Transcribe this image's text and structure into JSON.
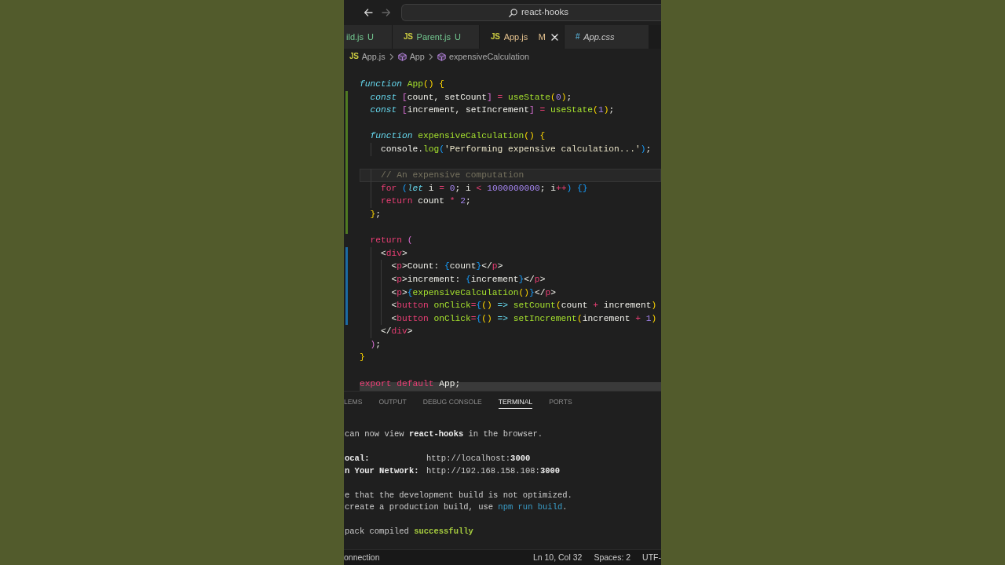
{
  "title_bar": {
    "nav_buttons": [
      {
        "kind": "back",
        "disabled": false
      },
      {
        "kind": "forward",
        "disabled": true
      }
    ],
    "command_center": {
      "label": "react-hooks"
    }
  },
  "tabs": [
    {
      "label": "ild.js",
      "badge": "U",
      "color": "#73c991",
      "selected": false,
      "preview": false
    },
    {
      "icon": {
        "text": "JS",
        "color": "#cbcb41"
      },
      "label": "Parent.js",
      "badge": "U",
      "color": "#73c991",
      "selected": false,
      "preview": false
    },
    {
      "icon": {
        "text": "JS",
        "color": "#cbcb41"
      },
      "label": "App.js",
      "badge": "M",
      "color": "#e2c08d",
      "selected": true,
      "preview": false
    },
    {
      "icon": {
        "text": "#",
        "color": "#519aba"
      },
      "label": "App.css",
      "color": "#c8c8c8",
      "selected": false,
      "preview": true
    }
  ],
  "breadcrumb": [
    {
      "kind": "file",
      "icon": {
        "text": "JS",
        "color": "#cbcb41"
      },
      "label": "App.js"
    },
    {
      "kind": "symbol",
      "label": "App"
    },
    {
      "kind": "symbol",
      "label": "expensiveCalculation"
    }
  ],
  "editor": {
    "lines": [
      {
        "kind": "code",
        "highlighted": false,
        "tokens": [
          {
            "text": "function ",
            "kind": "storage"
          },
          {
            "text": "App",
            "kind": "entity"
          },
          {
            "text": "() ",
            "kind": "bracket1"
          },
          {
            "text": "{",
            "kind": "bracket1"
          }
        ],
        "children": [
          {
            "kind": "code",
            "change_bar": {
              "color": "#4f7a21"
            },
            "highlighted": false,
            "tokens": [
              {
                "text": "const ",
                "kind": "storage"
              },
              {
                "text": "[",
                "kind": "bracket2"
              },
              {
                "text": "count, setCount",
                "kind": "plain"
              },
              {
                "text": "]",
                "kind": "bracket2"
              },
              {
                "text": " = ",
                "kind": "operator"
              },
              {
                "text": "useState",
                "kind": "entity"
              },
              {
                "text": "(",
                "kind": "bracket1"
              },
              {
                "text": "0",
                "kind": "number"
              },
              {
                "text": ")",
                "kind": "bracket1"
              },
              {
                "text": ";",
                "kind": "plain"
              }
            ]
          },
          {
            "kind": "code",
            "change_bar": {
              "color": "#4f7a21"
            },
            "highlighted": false,
            "tokens": [
              {
                "text": "const ",
                "kind": "storage"
              },
              {
                "text": "[",
                "kind": "bracket2"
              },
              {
                "text": "increment, setIncrement",
                "kind": "plain"
              },
              {
                "text": "]",
                "kind": "bracket2"
              },
              {
                "text": " = ",
                "kind": "operator"
              },
              {
                "text": "useState",
                "kind": "entity"
              },
              {
                "text": "(",
                "kind": "bracket1"
              },
              {
                "text": "1",
                "kind": "number"
              },
              {
                "text": ")",
                "kind": "bracket1"
              },
              {
                "text": ";",
                "kind": "plain"
              }
            ]
          },
          {
            "kind": "blank",
            "change_bar": {
              "color": "#4f7a21"
            },
            "highlighted": false
          },
          {
            "kind": "code",
            "change_bar": {
              "color": "#4f7a21"
            },
            "highlighted": false,
            "tokens": [
              {
                "text": "function ",
                "kind": "storage"
              },
              {
                "text": "expensiveCalculation",
                "kind": "entity"
              },
              {
                "text": "() ",
                "kind": "bracket1"
              },
              {
                "text": "{",
                "kind": "bracket1"
              }
            ],
            "children": [
              {
                "kind": "code",
                "change_bar": {
                  "color": "#4f7a21"
                },
                "highlighted": false,
                "tokens": [
                  {
                    "text": "console.",
                    "kind": "plain"
                  },
                  {
                    "text": "log",
                    "kind": "entity"
                  },
                  {
                    "text": "(",
                    "kind": "bracket3"
                  },
                  {
                    "text": "'Performing expensive calculation...'",
                    "kind": "string"
                  },
                  {
                    "text": ")",
                    "kind": "bracket3"
                  },
                  {
                    "text": ";",
                    "kind": "plain"
                  }
                ]
              },
              {
                "kind": "blank",
                "change_bar": {
                  "color": "#4f7a21"
                },
                "highlighted": false
              },
              {
                "kind": "code",
                "change_bar": {
                  "color": "#4f7a21"
                },
                "highlighted": true,
                "tokens": [
                  {
                    "text": "// An expensive computation",
                    "kind": "comment"
                  }
                ]
              },
              {
                "kind": "code",
                "change_bar": {
                  "color": "#4f7a21"
                },
                "highlighted": false,
                "tokens": [
                  {
                    "text": "for ",
                    "kind": "keyword"
                  },
                  {
                    "text": "(",
                    "kind": "bracket3"
                  },
                  {
                    "text": "let ",
                    "kind": "storage"
                  },
                  {
                    "text": "i ",
                    "kind": "plain"
                  },
                  {
                    "text": "= ",
                    "kind": "operator"
                  },
                  {
                    "text": "0",
                    "kind": "number"
                  },
                  {
                    "text": "; i ",
                    "kind": "plain"
                  },
                  {
                    "text": "< ",
                    "kind": "operator"
                  },
                  {
                    "text": "1000000000",
                    "kind": "number"
                  },
                  {
                    "text": "; i",
                    "kind": "plain"
                  },
                  {
                    "text": "++",
                    "kind": "operator"
                  },
                  {
                    "text": ") ",
                    "kind": "bracket3"
                  },
                  {
                    "text": "{}",
                    "kind": "bracket3"
                  }
                ]
              },
              {
                "kind": "code",
                "change_bar": {
                  "color": "#4f7a21"
                },
                "highlighted": false,
                "tokens": [
                  {
                    "text": "return ",
                    "kind": "keyword"
                  },
                  {
                    "text": "count ",
                    "kind": "plain"
                  },
                  {
                    "text": "* ",
                    "kind": "operator"
                  },
                  {
                    "text": "2",
                    "kind": "number"
                  },
                  {
                    "text": ";",
                    "kind": "plain"
                  }
                ]
              }
            ]
          },
          {
            "kind": "code",
            "change_bar": {
              "color": "#4f7a21"
            },
            "highlighted": false,
            "tokens": [
              {
                "text": "}",
                "kind": "bracket1"
              },
              {
                "text": ";",
                "kind": "plain"
              }
            ]
          },
          {
            "kind": "blank",
            "change_bar": {
              "color": "#4f7a21"
            },
            "highlighted": false
          },
          {
            "kind": "code",
            "highlighted": false,
            "tokens": [
              {
                "text": "return ",
                "kind": "keyword"
              },
              {
                "text": "(",
                "kind": "bracket2"
              }
            ],
            "children": [
              {
                "kind": "code",
                "change_bar": {
                  "color": "#1c6aa3"
                },
                "highlighted": false,
                "tokens": [
                  {
                    "text": "<",
                    "kind": "plain"
                  },
                  {
                    "text": "div",
                    "kind": "keyword"
                  },
                  {
                    "text": ">",
                    "kind": "plain"
                  }
                ],
                "children": [
                  {
                    "kind": "code",
                    "change_bar": {
                      "color": "#1c6aa3"
                    },
                    "highlighted": false,
                    "tokens": [
                      {
                        "text": "<",
                        "kind": "plain"
                      },
                      {
                        "text": "p",
                        "kind": "keyword"
                      },
                      {
                        "text": ">Count: ",
                        "kind": "plain"
                      },
                      {
                        "text": "{",
                        "kind": "bracket3"
                      },
                      {
                        "text": "count",
                        "kind": "plain"
                      },
                      {
                        "text": "}",
                        "kind": "bracket3"
                      },
                      {
                        "text": "</",
                        "kind": "plain"
                      },
                      {
                        "text": "p",
                        "kind": "keyword"
                      },
                      {
                        "text": ">",
                        "kind": "plain"
                      }
                    ]
                  },
                  {
                    "kind": "code",
                    "change_bar": {
                      "color": "#1c6aa3"
                    },
                    "highlighted": false,
                    "tokens": [
                      {
                        "text": "<",
                        "kind": "plain"
                      },
                      {
                        "text": "p",
                        "kind": "keyword"
                      },
                      {
                        "text": ">increment: ",
                        "kind": "plain"
                      },
                      {
                        "text": "{",
                        "kind": "bracket3"
                      },
                      {
                        "text": "increment",
                        "kind": "plain"
                      },
                      {
                        "text": "}",
                        "kind": "bracket3"
                      },
                      {
                        "text": "</",
                        "kind": "plain"
                      },
                      {
                        "text": "p",
                        "kind": "keyword"
                      },
                      {
                        "text": ">",
                        "kind": "plain"
                      }
                    ]
                  },
                  {
                    "kind": "code",
                    "change_bar": {
                      "color": "#1c6aa3"
                    },
                    "highlighted": false,
                    "tokens": [
                      {
                        "text": "<",
                        "kind": "plain"
                      },
                      {
                        "text": "p",
                        "kind": "keyword"
                      },
                      {
                        "text": ">",
                        "kind": "plain"
                      },
                      {
                        "text": "{",
                        "kind": "bracket3"
                      },
                      {
                        "text": "expensiveCalculation",
                        "kind": "entity"
                      },
                      {
                        "text": "()",
                        "kind": "bracket1"
                      },
                      {
                        "text": "}",
                        "kind": "bracket3"
                      },
                      {
                        "text": "</",
                        "kind": "plain"
                      },
                      {
                        "text": "p",
                        "kind": "keyword"
                      },
                      {
                        "text": ">",
                        "kind": "plain"
                      }
                    ]
                  },
                  {
                    "kind": "code",
                    "change_bar": {
                      "color": "#1c6aa3"
                    },
                    "highlighted": false,
                    "tokens": [
                      {
                        "text": "<",
                        "kind": "plain"
                      },
                      {
                        "text": "button ",
                        "kind": "keyword"
                      },
                      {
                        "text": "onClick",
                        "kind": "entity"
                      },
                      {
                        "text": "=",
                        "kind": "operator"
                      },
                      {
                        "text": "{",
                        "kind": "bracket3"
                      },
                      {
                        "text": "() ",
                        "kind": "bracket1"
                      },
                      {
                        "text": "=> ",
                        "kind": "type"
                      },
                      {
                        "text": "setCount",
                        "kind": "entity"
                      },
                      {
                        "text": "(",
                        "kind": "bracket1"
                      },
                      {
                        "text": "count ",
                        "kind": "plain"
                      },
                      {
                        "text": "+ ",
                        "kind": "operator"
                      },
                      {
                        "text": "increment",
                        "kind": "plain"
                      },
                      {
                        "text": ")",
                        "kind": "bracket1"
                      }
                    ]
                  },
                  {
                    "kind": "code",
                    "change_bar": {
                      "color": "#1c6aa3"
                    },
                    "highlighted": false,
                    "tokens": [
                      {
                        "text": "<",
                        "kind": "plain"
                      },
                      {
                        "text": "button ",
                        "kind": "keyword"
                      },
                      {
                        "text": "onClick",
                        "kind": "entity"
                      },
                      {
                        "text": "=",
                        "kind": "operator"
                      },
                      {
                        "text": "{",
                        "kind": "bracket3"
                      },
                      {
                        "text": "() ",
                        "kind": "bracket1"
                      },
                      {
                        "text": "=> ",
                        "kind": "type"
                      },
                      {
                        "text": "setIncrement",
                        "kind": "entity"
                      },
                      {
                        "text": "(",
                        "kind": "bracket1"
                      },
                      {
                        "text": "increment ",
                        "kind": "plain"
                      },
                      {
                        "text": "+ ",
                        "kind": "operator"
                      },
                      {
                        "text": "1",
                        "kind": "number"
                      },
                      {
                        "text": ")",
                        "kind": "bracket1"
                      }
                    ]
                  }
                ]
              },
              {
                "kind": "code",
                "highlighted": false,
                "tokens": [
                  {
                    "text": "</",
                    "kind": "plain"
                  },
                  {
                    "text": "div",
                    "kind": "keyword"
                  },
                  {
                    "text": ">",
                    "kind": "plain"
                  }
                ]
              }
            ]
          },
          {
            "kind": "code",
            "highlighted": false,
            "tokens": [
              {
                "text": ")",
                "kind": "bracket2"
              },
              {
                "text": ";",
                "kind": "plain"
              }
            ]
          }
        ]
      },
      {
        "kind": "code",
        "highlighted": false,
        "tokens": [
          {
            "text": "}",
            "kind": "bracket1"
          }
        ]
      },
      {
        "kind": "blank",
        "highlighted": false
      },
      {
        "kind": "code",
        "highlighted": false,
        "tokens": [
          {
            "text": "export ",
            "kind": "keyword"
          },
          {
            "text": "default ",
            "kind": "keyword"
          },
          {
            "text": "App;",
            "kind": "plain"
          }
        ]
      }
    ]
  },
  "panel": {
    "tabs": [
      {
        "label": "LEMS",
        "selected": false
      },
      {
        "label": "OUTPUT",
        "selected": false
      },
      {
        "label": "DEBUG CONSOLE",
        "selected": false
      },
      {
        "label": "TERMINAL",
        "selected": true
      },
      {
        "label": "PORTS",
        "selected": false
      }
    ],
    "terminal_lines": [
      {
        "kind": "text",
        "segments": [
          {
            "text": "can now view **react-hooks** in the browser."
          }
        ]
      },
      {
        "kind": "blank"
      },
      {
        "kind": "pair",
        "label": "ocal:",
        "value": "http://localhost:**3000**"
      },
      {
        "kind": "pair",
        "label": "n Your Network:",
        "value": "http://192.168.158.108:**3000**"
      },
      {
        "kind": "blank"
      },
      {
        "kind": "text",
        "segments": [
          {
            "text": "e that the development build is not optimized."
          }
        ]
      },
      {
        "kind": "text",
        "segments": [
          {
            "text": "create a production build, use "
          },
          {
            "text": "npm run build",
            "kind": "command"
          },
          {
            "text": "."
          }
        ]
      },
      {
        "kind": "blank"
      },
      {
        "kind": "text",
        "segments": [
          {
            "text": "pack compiled "
          },
          {
            "text": "successfully",
            "kind": "success"
          }
        ]
      }
    ]
  },
  "status_bar": {
    "left": [
      "onnection"
    ],
    "right": [
      "Ln 10, Col 32",
      "Spaces: 2",
      "UTF-"
    ]
  }
}
